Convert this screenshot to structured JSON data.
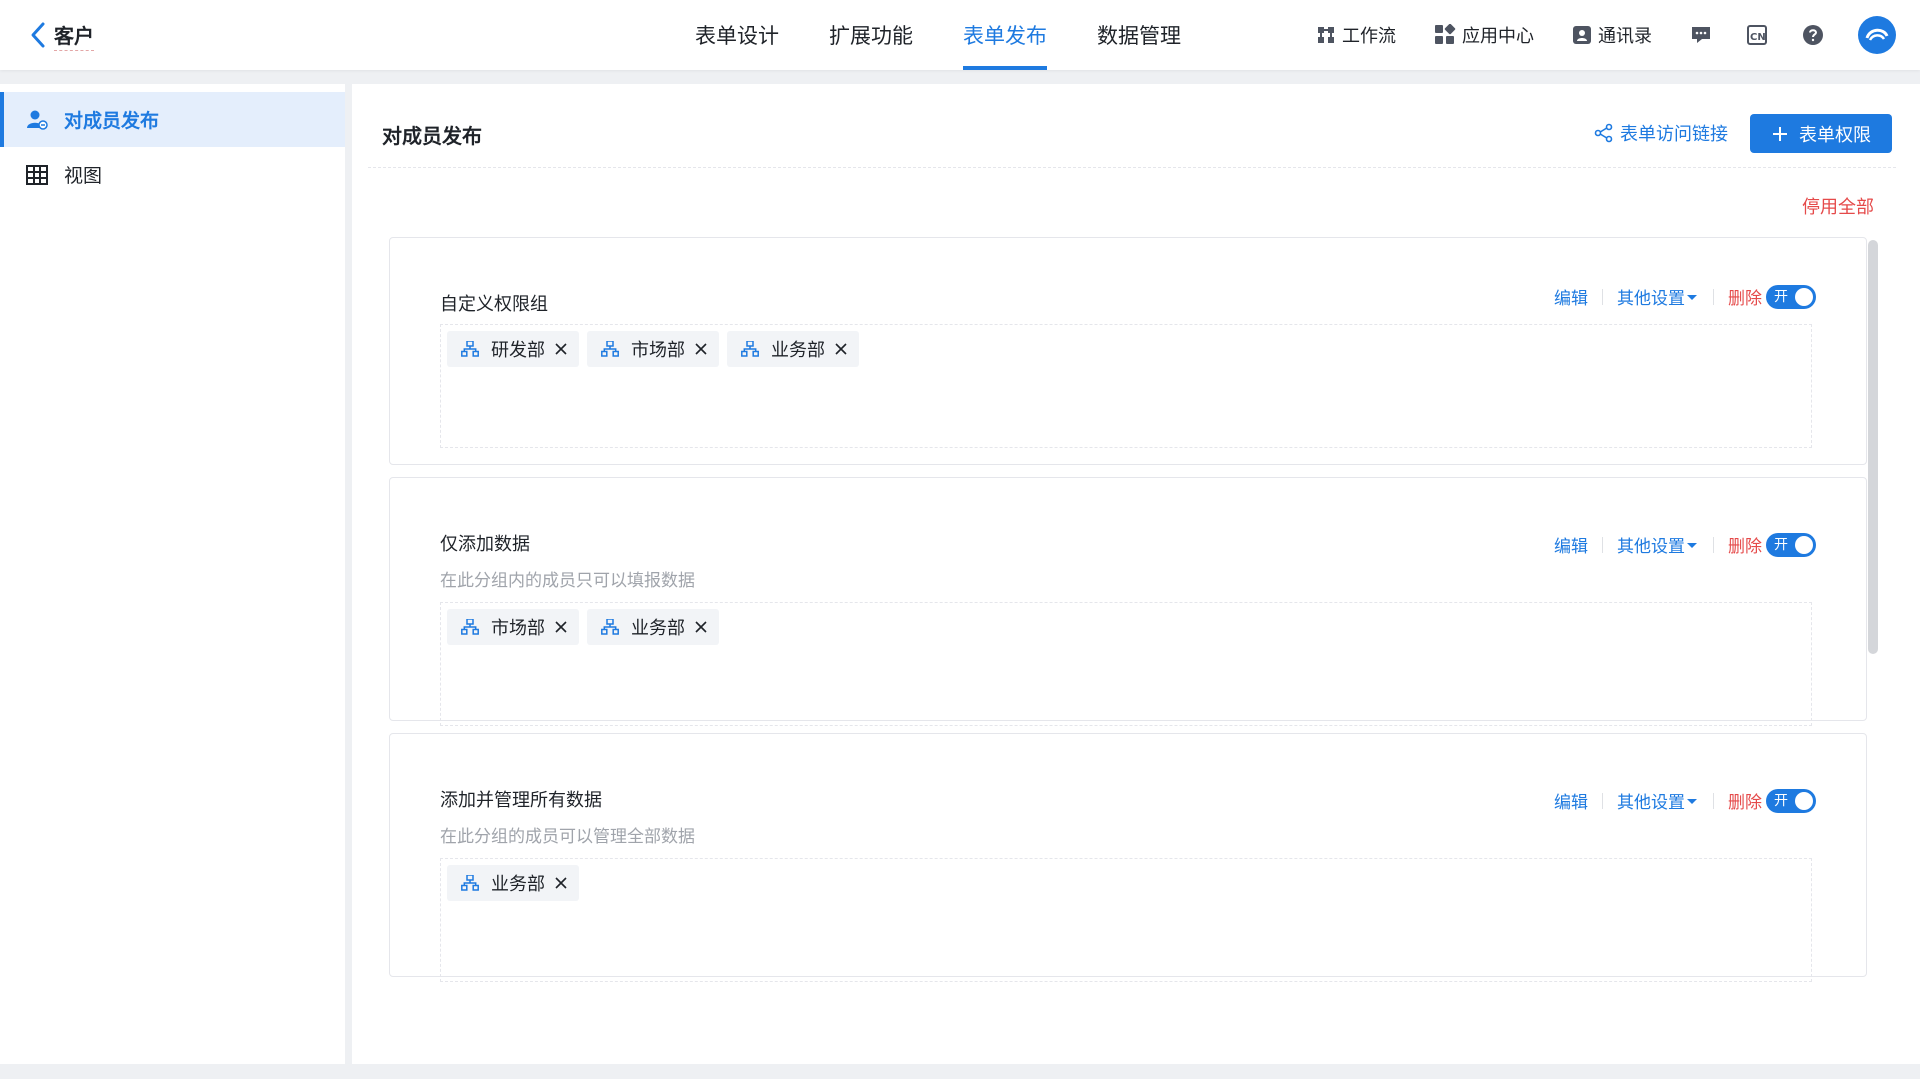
{
  "header": {
    "back_title": "客户",
    "tabs": [
      {
        "label": "表单设计"
      },
      {
        "label": "扩展功能"
      },
      {
        "label": "表单发布"
      },
      {
        "label": "数据管理"
      }
    ],
    "active_tab": "表单发布",
    "right": {
      "workflow": "工作流",
      "app_center": "应用中心",
      "contacts": "通讯录",
      "lang": "CN"
    }
  },
  "sidebar": {
    "items": [
      {
        "label": "对成员发布",
        "icon": "user-share-icon"
      },
      {
        "label": "视图",
        "icon": "table-grid-icon"
      }
    ]
  },
  "main": {
    "title": "对成员发布",
    "access_link": "表单访问链接",
    "add_permission": "表单权限",
    "disable_all": "停用全部",
    "groups": [
      {
        "title": "自定义权限组",
        "desc": "",
        "members": [
          "研发部",
          "市场部",
          "业务部"
        ]
      },
      {
        "title": "仅添加数据",
        "desc": "在此分组内的成员只可以填报数据",
        "members": [
          "市场部",
          "业务部"
        ]
      },
      {
        "title": "添加并管理所有数据",
        "desc": "在此分组的成员可以管理全部数据",
        "members": [
          "业务部"
        ]
      }
    ],
    "actions": {
      "edit": "编辑",
      "other": "其他设置",
      "delete": "删除",
      "toggle_on": "开"
    }
  },
  "colors": {
    "primary": "#1e7ae0",
    "danger": "#e54a4a",
    "muted": "#a0a4ab"
  }
}
